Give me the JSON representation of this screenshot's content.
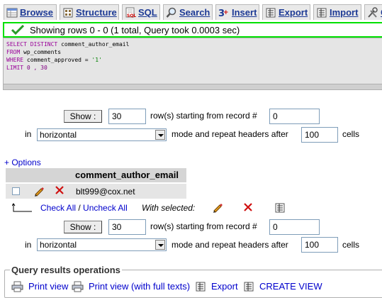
{
  "tabs": [
    {
      "label": "Browse",
      "icon": "browse-icon"
    },
    {
      "label": "Structure",
      "icon": "structure-icon"
    },
    {
      "label": "SQL",
      "icon": "sql-icon"
    },
    {
      "label": "Search",
      "icon": "search-icon"
    },
    {
      "label": "Insert",
      "icon": "insert-icon"
    },
    {
      "label": "Export",
      "icon": "export-icon"
    },
    {
      "label": "Import",
      "icon": "import-icon"
    },
    {
      "label": "O",
      "icon": "operations-icon"
    }
  ],
  "success_message": "Showing rows 0 - 0 (1 total, Query took 0.0003 sec)",
  "sql": {
    "line1_kw": "SELECT DISTINCT",
    "line1_rest": " comment_author_email",
    "line2_kw": "FROM",
    "line2_rest": " wp_comments",
    "line3_kw": "WHERE",
    "line3_mid": " comment_approved = ",
    "line3_str": "'1'",
    "line4_kw": "LIMIT",
    "line4_rest": " 0 , 30"
  },
  "nav_top": {
    "show_label": "Show :",
    "rows_value": "30",
    "starting_text": "row(s) starting from record #",
    "start_value": "0",
    "in_label": "in",
    "mode_value": "horizontal",
    "repeat_text": "mode and repeat headers after",
    "repeat_value": "100",
    "cells_label": "cells"
  },
  "nav_bottom": {
    "show_label": "Show :",
    "rows_value": "30",
    "starting_text": "row(s) starting from record #",
    "start_value": "0",
    "in_label": "in",
    "mode_value": "horizontal",
    "repeat_text": "mode and repeat headers after",
    "repeat_value": "100",
    "cells_label": "cells"
  },
  "options_link": "+ Options",
  "results": {
    "column_header": "comment_author_email",
    "rows": [
      {
        "value": "blt999@cox.net"
      }
    ]
  },
  "bulk": {
    "check_all": "Check All",
    "separator": " / ",
    "uncheck_all": "Uncheck All",
    "with_selected": "With selected:"
  },
  "operations": {
    "legend": "Query results operations",
    "print_view": "Print view",
    "print_view_full": "Print view (with full texts)",
    "export": "Export",
    "create_view": "CREATE VIEW"
  }
}
